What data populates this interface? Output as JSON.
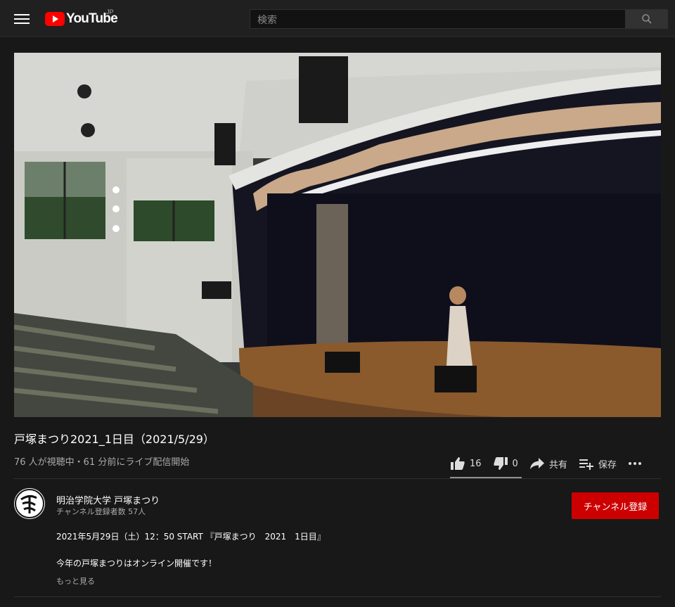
{
  "header": {
    "logo_text": "YouTube",
    "region": "JP",
    "search_placeholder": "検索",
    "icons": [
      "menu-icon",
      "youtube-logo-icon",
      "search-icon"
    ]
  },
  "video": {
    "title": "戸塚まつり2021_1日目（2021/5/29）",
    "meta": "76 人が視聴中・61 分前にライブ配信開始",
    "likes": "16",
    "dislikes": "0",
    "share_label": "共有",
    "save_label": "保存"
  },
  "channel": {
    "name": "明治学院大学 戸塚まつり",
    "subscribers": "チャンネル登録者数 57人",
    "subscribe_label": "チャンネル登録"
  },
  "description": {
    "line1": "2021年5月29日（土）12：50 START 『戸塚まつり　2021　1日目』",
    "line2": "今年の戸塚まつりはオンライン開催です！",
    "show_more": "もっと見る"
  },
  "colors": {
    "background": "#181818",
    "header": "#202020",
    "subscribe": "#cc0000",
    "logo_red": "#ff0000"
  }
}
